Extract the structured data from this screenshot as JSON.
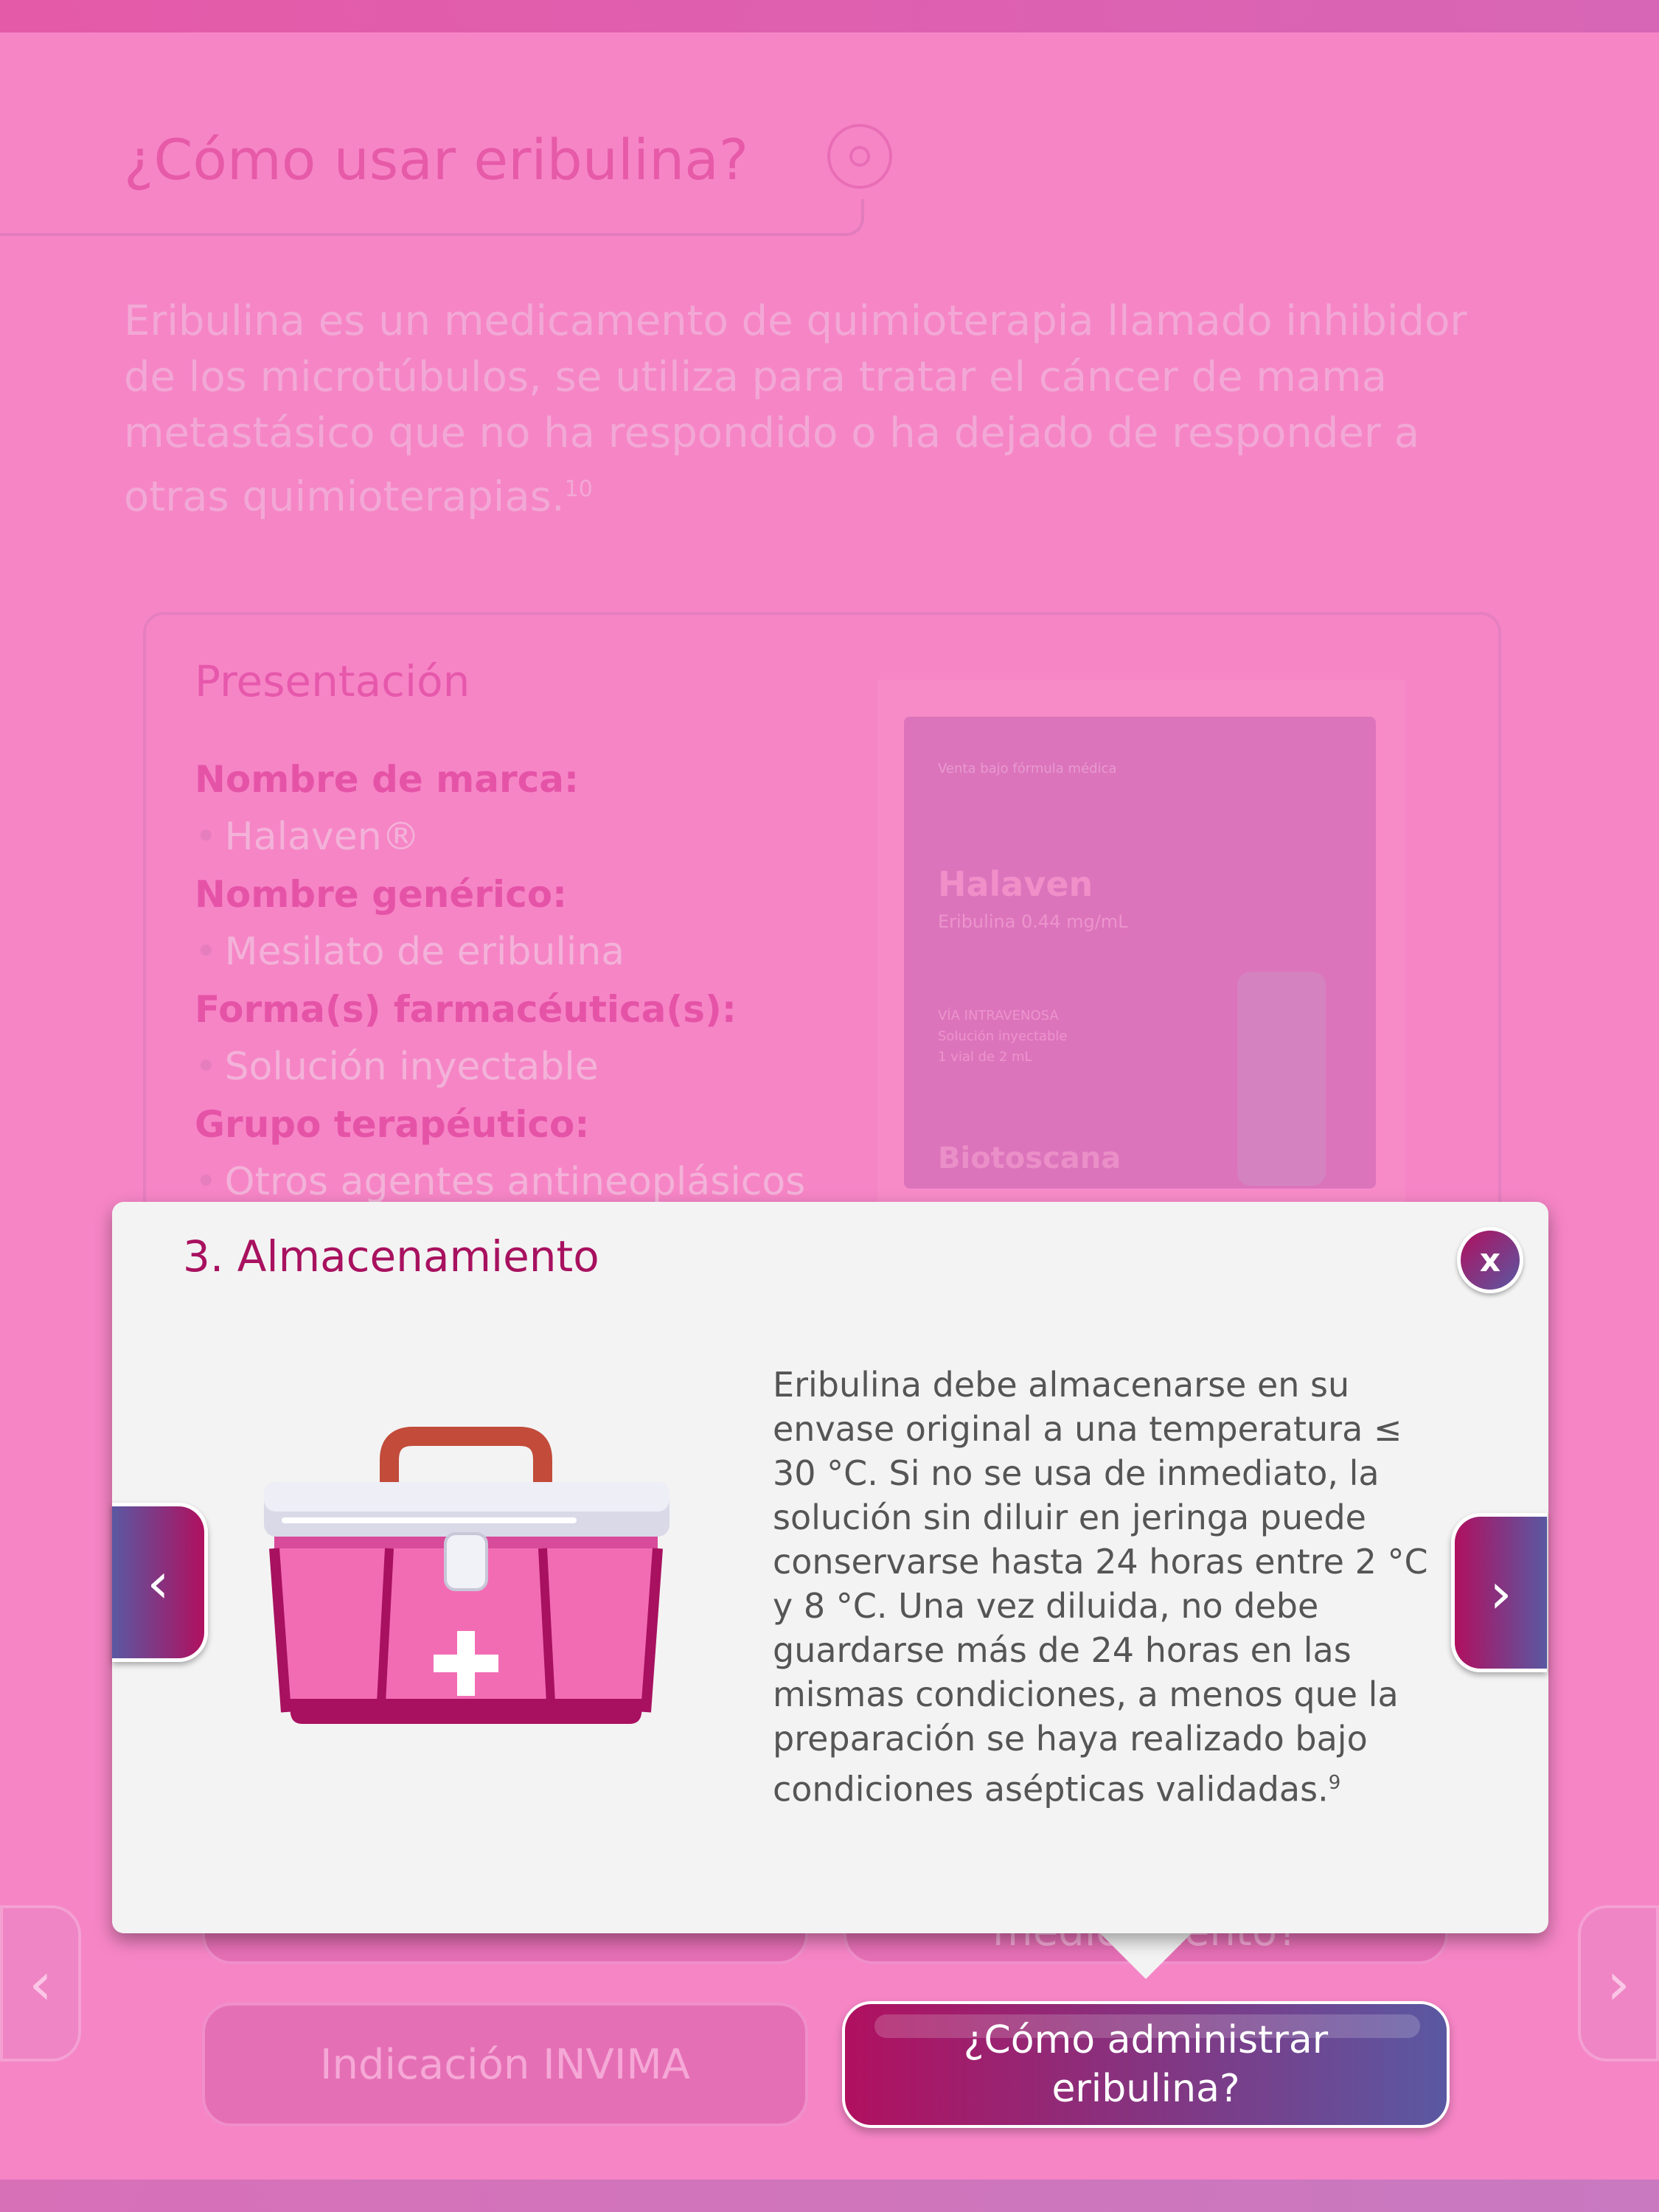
{
  "page": {
    "title": "¿Cómo usar eribulina?",
    "intro": "Eribulina es un medicamento de quimioterapia llamado inhibidor de los microtúbulos, se utiliza para tratar el cáncer de mama metastásico que no ha respondido o ha dejado de responder a otras quimioterapias.",
    "intro_ref": "10"
  },
  "presentation": {
    "title": "Presentación",
    "items": [
      {
        "label": "Nombre de marca:",
        "value": "Halaven®"
      },
      {
        "label": "Nombre genérico:",
        "value": "Mesilato de eribulina"
      },
      {
        "label": "Forma(s) farmacéutica(s):",
        "value": "Solución inyectable"
      },
      {
        "label": "Grupo terapéutico:",
        "value": "Otros agentes antineoplásicos"
      }
    ],
    "product_box": {
      "top_note": "Venta bajo fórmula médica",
      "brand": "Halaven",
      "strength": "Eribulina 0.44 mg/mL",
      "route": "VÍA INTRAVENOSA",
      "form": "Solución inyectable",
      "pack": "1 vial de 2 mL",
      "maker": "Biotoscana"
    }
  },
  "modal": {
    "title": "3. Almacenamiento",
    "close_label": "x",
    "body": "Eribulina debe almacenarse en su envase original a una temperatura ≤ 30 °C. Si no se usa de inmediato, la solución sin diluir en jeringa puede conservarse hasta 24 horas entre 2 °C y 8 °C. Una vez diluida, no debe guardarse más de 24 horas en las mismas condiciones, a menos que la preparación se haya realizado bajo condiciones asépticas validadas.",
    "body_ref": "9",
    "prev_icon": "chevron-left-icon",
    "next_icon": "chevron-right-icon",
    "image_icon": "medical-kit-icon"
  },
  "bottom_nav": {
    "partial_right_label": "medicamento?",
    "indication_label": "Indicación INVIMA",
    "active_label": "¿Cómo administrar eribulina?"
  },
  "colors": {
    "background": "#f685c6",
    "accent": "#a8115f",
    "accent_gradient_end": "#5a58a2"
  }
}
